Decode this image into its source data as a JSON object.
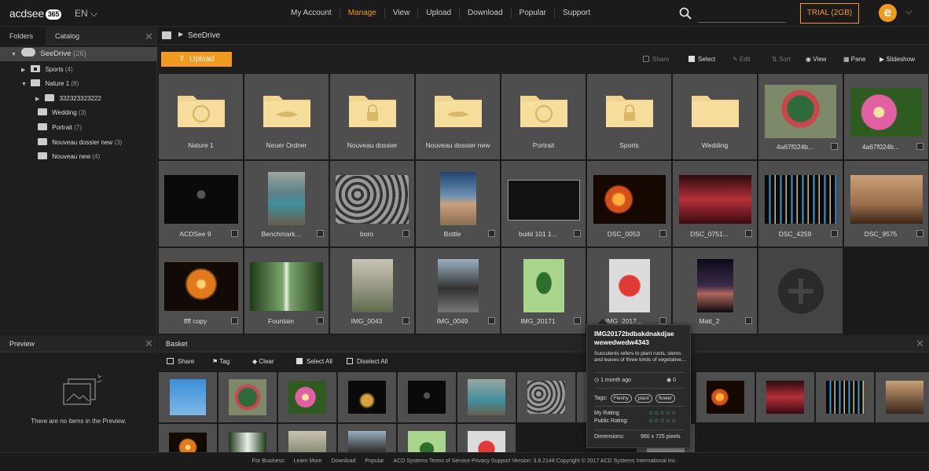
{
  "topbar": {
    "logo": "acdsee",
    "logo_badge": "365",
    "lang": "EN",
    "nav": [
      "My Account",
      "Manage",
      "View",
      "Upload",
      "Download",
      "Popular",
      "Support"
    ],
    "active_nav": "Manage",
    "trial": "TRIAL (2GB)",
    "avatar_letter": "e",
    "accent": "#f29a1f"
  },
  "left": {
    "tabs": [
      "Folders",
      "Catalog"
    ],
    "tree": [
      {
        "label": "SeeDrive",
        "count": "(26)"
      },
      {
        "label": "Sports",
        "count": "(4)"
      },
      {
        "label": "Nature 1",
        "count": "(8)"
      },
      {
        "label": "332323323222",
        "count": ""
      },
      {
        "label": "Wedding",
        "count": "(3)"
      },
      {
        "label": "Portrait",
        "count": "(7)"
      },
      {
        "label": "Nouveau dossier new",
        "count": "(3)"
      },
      {
        "label": "Nouveau new",
        "count": "(4)"
      }
    ]
  },
  "breadcrumb": {
    "label": "SeeDrive"
  },
  "toolbar": {
    "upload": "Upload",
    "share": "Share",
    "select": "Select",
    "edit": "Edit",
    "sort": "Sort",
    "view": "View",
    "pane": "Pane",
    "slideshow": "Slideshow"
  },
  "grid": {
    "items": [
      "Nature 1",
      "Neuer Ordner",
      "Nouveau dossier",
      "Nouveau dossier new",
      "Portrait",
      "Sports",
      "Wedding",
      "4a67f024b...",
      "4a67f024b...",
      "ACDSee 9",
      "Benchmark...",
      "boro",
      "Bottle",
      "build 101 1...",
      "DSC_0053",
      "DSC_0751...",
      "DSC_4259",
      "DSC_9575",
      "ffff copy",
      "Fountain",
      "IMG_0043",
      "IMG_0049",
      "IMG_20171",
      "IMG_2017...",
      "Matt_2"
    ]
  },
  "preview": {
    "title": "Preview",
    "empty": "There are no items in the Preview."
  },
  "basket": {
    "title": "Basket",
    "share": "Share",
    "tag": "Tag",
    "clear": "Clear",
    "select_all": "Select All",
    "deselect_all": "Diselect All"
  },
  "popup": {
    "title": "IMG20172bdbakdnakdjae wewedwedw4343",
    "description": "Succulents refers to plant roots, stems and leaves of three kinds of vegetative...",
    "date": "1 month ago",
    "views": "0",
    "tags_label": "Tags:",
    "tags": [
      "Fleshy",
      "plant",
      "flower"
    ],
    "my_rating_label": "My Rating:",
    "public_rating_label": "Public Rating:",
    "stars": "☆☆☆☆☆",
    "dimensions_label": "Dimensions:",
    "dimensions": "960 x 725 pixels"
  },
  "footer": {
    "links": [
      "For Business",
      "Learn More",
      "Download",
      "Popular",
      "ACD Systems Terms of Service Privacy Support Version: 3.8.2148 Copyright © 2017 ACD Systems International Inc."
    ]
  }
}
